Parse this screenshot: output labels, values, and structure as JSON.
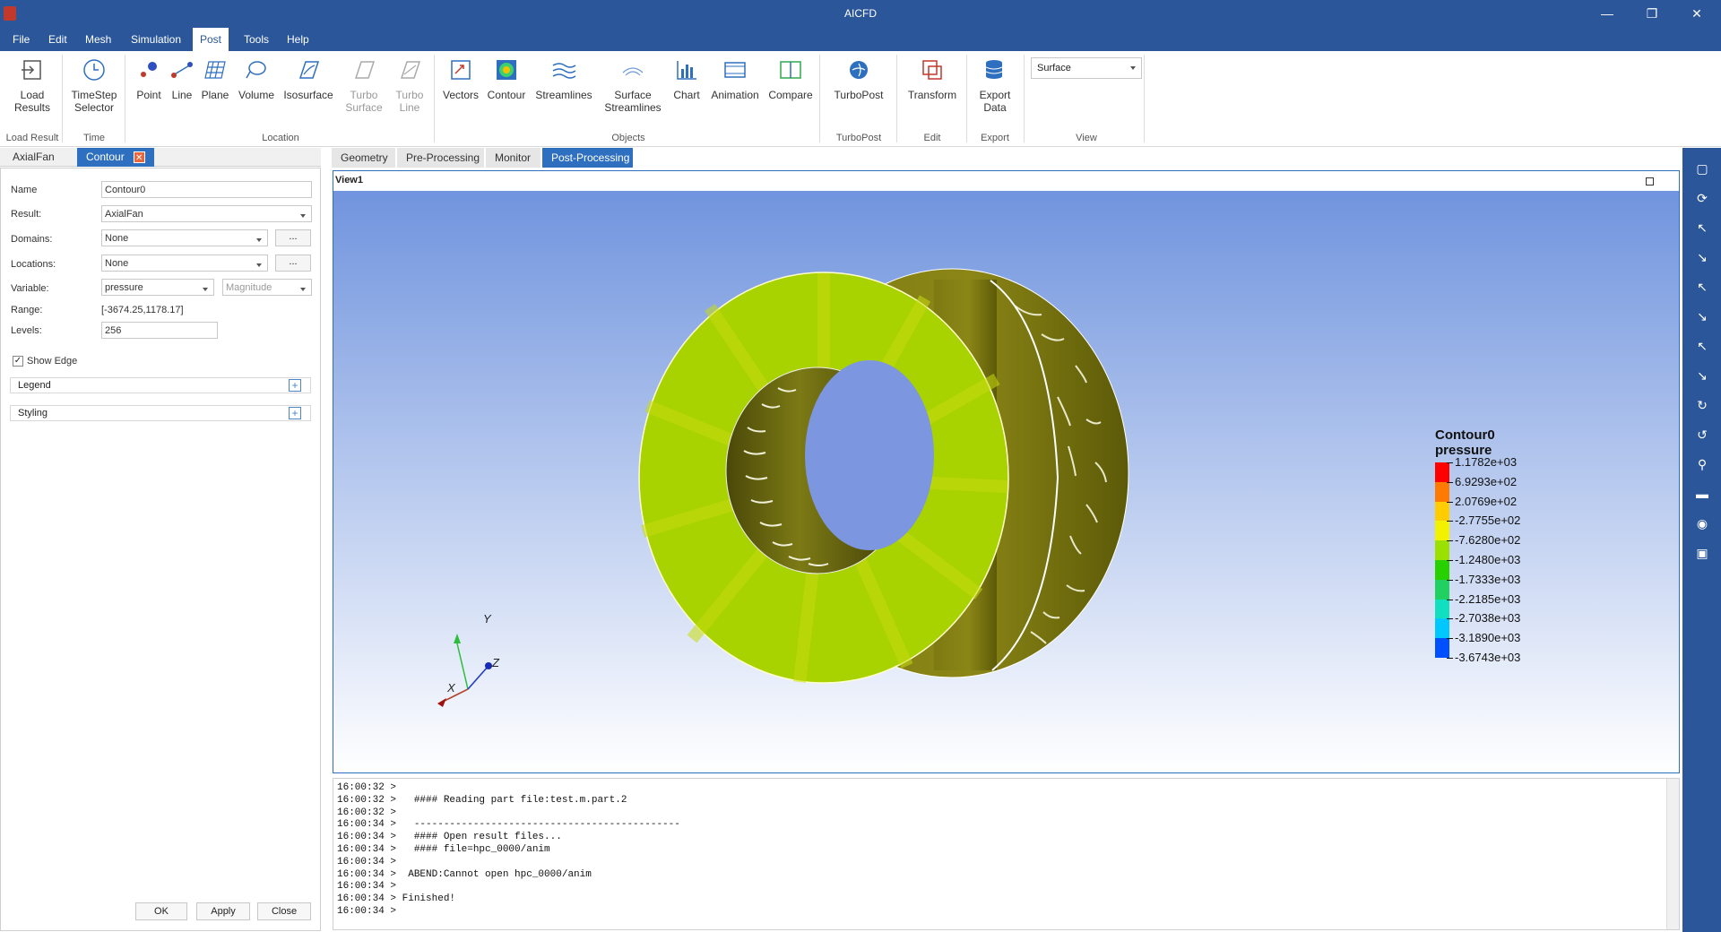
{
  "window": {
    "title": "AICFD"
  },
  "menu": [
    "File",
    "Edit",
    "Mesh",
    "Simulation",
    "Post",
    "Tools",
    "Help"
  ],
  "menu_active": "Post",
  "ribbon": {
    "buttons": {
      "load_results": "Load\nResults",
      "timestep": "TimeStep\nSelector",
      "point": "Point",
      "line": "Line",
      "plane": "Plane",
      "volume": "Volume",
      "isosurface": "Isosurface",
      "turbo_surface": "Turbo\nSurface",
      "turbo_line": "Turbo\nLine",
      "vectors": "Vectors",
      "contour": "Contour",
      "streamlines": "Streamlines",
      "surface_streamlines": "Surface\nStreamlines",
      "chart": "Chart",
      "animation": "Animation",
      "compare": "Compare",
      "turbopost": "TurboPost",
      "transform": "Transform",
      "export_data": "Export\nData"
    },
    "groups": {
      "load_result": "Load Result",
      "time": "Time",
      "location": "Location",
      "objects": "Objects",
      "turbopost": "TurboPost",
      "edit": "Edit",
      "export": "Export",
      "view": "View"
    },
    "view_select": "Surface"
  },
  "left_tabs": {
    "axialfan": "AxialFan",
    "contour": "Contour"
  },
  "form": {
    "name_label": "Name",
    "name_value": "Contour0",
    "result_label": "Result:",
    "result_value": "AxialFan",
    "domains_label": "Domains:",
    "domains_value": "None",
    "locations_label": "Locations:",
    "locations_value": "None",
    "variable_label": "Variable:",
    "variable_value": "pressure",
    "variable_mode": "Magnitude",
    "range_label": "Range:",
    "range_value": "[-3674.25,1178.17]",
    "levels_label": "Levels:",
    "levels_value": "256",
    "show_edge_label": "Show Edge",
    "show_edge_checked": true,
    "legend_section": "Legend",
    "styling_section": "Styling",
    "dots": "...",
    "ok": "OK",
    "apply": "Apply",
    "close": "Close"
  },
  "main_tabs": [
    "Geometry",
    "Pre-Processing",
    "Monitor",
    "Post-Processing"
  ],
  "main_tab_active": "Post-Processing",
  "view": {
    "title": "View1",
    "legend": {
      "title_line1": "Contour0",
      "title_line2": "pressure",
      "labels": [
        "1.1782e+03",
        "6.9293e+02",
        "2.0769e+02",
        "-2.7755e+02",
        "-7.6280e+02",
        "-1.2480e+03",
        "-1.7333e+03",
        "-2.2185e+03",
        "-2.7038e+03",
        "-3.1890e+03",
        "-3.6743e+03"
      ],
      "colors": [
        "#ff0000",
        "#ff7a00",
        "#ffcc00",
        "#f2f200",
        "#9be000",
        "#28d000",
        "#20d060",
        "#10e0c0",
        "#00c8ff",
        "#0050ff",
        "#0000e0"
      ]
    },
    "axes": {
      "x": "X",
      "y": "Y",
      "z": "Z"
    }
  },
  "console": [
    "16:00:32 >",
    "16:00:32 >   #### Reading part file:test.m.part.2",
    "16:00:32 >",
    "16:00:34 >   ---------------------------------------------",
    "16:00:34 >   #### Open result files...",
    "16:00:34 >   #### file=hpc_0000/anim",
    "16:00:34 >",
    "16:00:34 >  ABEND:Cannot open hpc_0000/anim",
    "16:00:34 >",
    "16:00:34 > Finished!",
    "16:00:34 >"
  ]
}
